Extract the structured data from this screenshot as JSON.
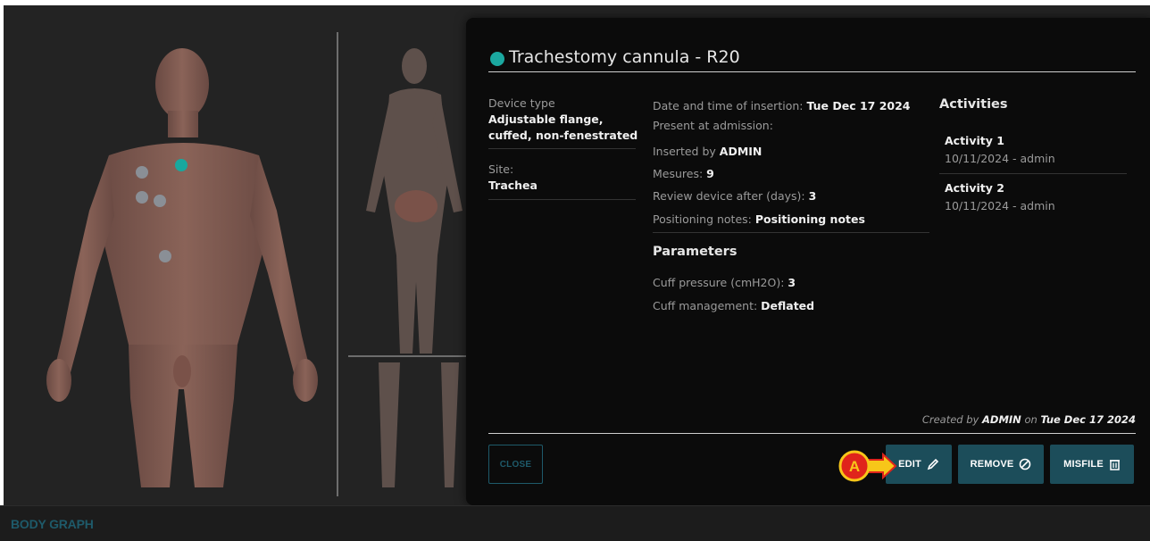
{
  "body_graph": {
    "footer_label": "BODY GRAPH"
  },
  "panel": {
    "title": "Trachestomy cannula - R20",
    "status_color": "#1ba8a0",
    "left_column": {
      "device_type_label": "Device type",
      "device_type_value_line1": "Adjustable flange,",
      "device_type_value_line2": "cuffed, non-fenestrated",
      "site_label": "Site:",
      "site_value": "Trachea"
    },
    "details": {
      "insertion_label": "Date and time of insertion: ",
      "insertion_value": "Tue Dec 17 2024",
      "present_label": "Present at admission:",
      "inserted_by_label": "Inserted by ",
      "inserted_by_value": "ADMIN",
      "mesures_label": "Mesures: ",
      "mesures_value": "9",
      "review_label": "Review device after (days): ",
      "review_value": "3",
      "positioning_label": "Positioning notes: ",
      "positioning_value": "Positioning notes"
    },
    "parameters": {
      "heading": "Parameters",
      "cuff_pressure_label": "Cuff pressure (cmH2O): ",
      "cuff_pressure_value": "3",
      "cuff_mgmt_label": "Cuff management: ",
      "cuff_mgmt_value": "Deflated"
    },
    "activities": {
      "heading": "Activities",
      "items": [
        {
          "title": "Activity 1",
          "subtitle": "10/11/2024 - admin"
        },
        {
          "title": "Activity 2",
          "subtitle": "10/11/2024 - admin"
        }
      ]
    },
    "created": {
      "prefix": "Created by ",
      "user": "ADMIN",
      "middle": " on ",
      "date": "Tue Dec 17 2024"
    },
    "buttons": {
      "close": "CLOSE",
      "edit": "EDIT",
      "remove": "REMOVE",
      "misfile": "MISFILE"
    },
    "callout_letter": "A"
  },
  "colors": {
    "accent_teal": "#1ba8a0",
    "button_teal": "#1c4d5a",
    "callout_red": "#e0241b",
    "callout_yellow": "#f7c619"
  }
}
